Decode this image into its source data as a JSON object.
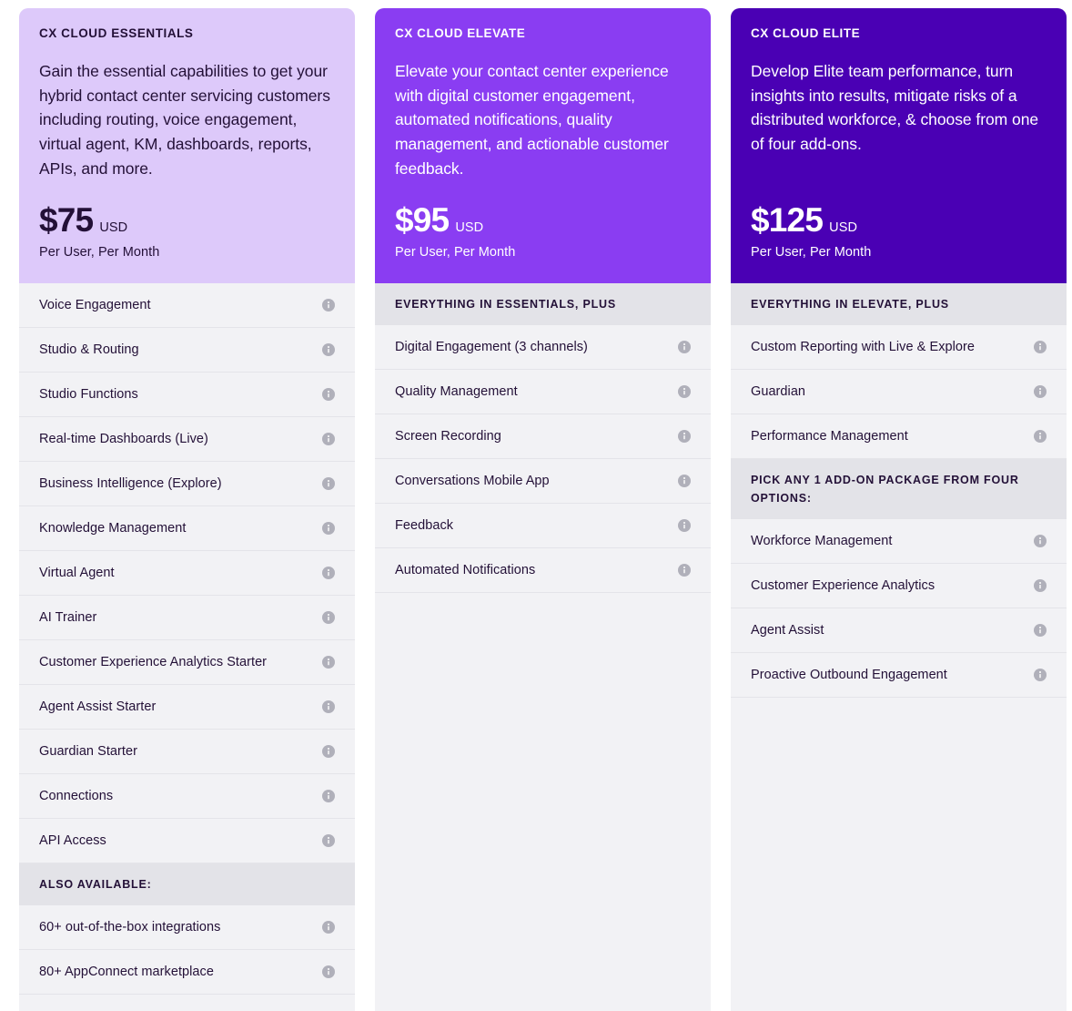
{
  "icons": {
    "info": "info-icon"
  },
  "colors": {
    "essentials_header_bg": "#ddc9fa",
    "elevate_header_bg": "#8a3df2",
    "elite_header_bg": "#4a00b4",
    "row_bg": "#f2f2f5",
    "section_heading_bg": "#e3e3e8",
    "text_dark": "#231037",
    "text_light": "#ffffff",
    "icon_gray": "#b0b0ba",
    "divider": "#e4e4e9"
  },
  "plans": [
    {
      "eyebrow": "CX CLOUD ESSENTIALS",
      "description": "Gain the essential capabilities to get your hybrid contact center servicing customers including routing, voice engagement, virtual agent, KM, dashboards, reports, APIs, and more.",
      "price_amount": "$75",
      "price_currency": "USD",
      "price_period": "Per User, Per Month",
      "blocks": [
        {
          "heading": null,
          "features": [
            "Voice Engagement",
            "Studio & Routing",
            "Studio Functions",
            "Real-time Dashboards (Live)",
            "Business Intelligence (Explore)",
            "Knowledge Management",
            "Virtual Agent",
            "AI Trainer",
            "Customer Experience Analytics Starter",
            "Agent Assist Starter",
            "Guardian Starter",
            "Connections",
            "API Access"
          ]
        },
        {
          "heading": "ALSO AVAILABLE:",
          "features": [
            "60+ out-of-the-box integrations",
            "80+ AppConnect marketplace"
          ]
        }
      ]
    },
    {
      "eyebrow": "CX CLOUD ELEVATE",
      "description": "Elevate your contact center experience with digital customer engagement, automated notifications, quality management, and actionable customer feedback.",
      "price_amount": "$95",
      "price_currency": "USD",
      "price_period": "Per User, Per Month",
      "blocks": [
        {
          "heading": "EVERYTHING IN ESSENTIALS, PLUS",
          "features": [
            "Digital Engagement (3 channels)",
            "Quality Management",
            "Screen Recording",
            "Conversations Mobile App",
            "Feedback",
            "Automated Notifications"
          ]
        }
      ]
    },
    {
      "eyebrow": "CX CLOUD ELITE",
      "description": "Develop Elite team performance, turn insights into results, mitigate risks of a distributed workforce, & choose from one of four add-ons.",
      "price_amount": "$125",
      "price_currency": "USD",
      "price_period": "Per User, Per Month",
      "blocks": [
        {
          "heading": "EVERYTHING IN ELEVATE, PLUS",
          "features": [
            "Custom Reporting with Live & Explore",
            "Guardian",
            "Performance Management"
          ]
        },
        {
          "heading": "PICK ANY 1 ADD-ON PACKAGE FROM FOUR OPTIONS:",
          "features": [
            "Workforce Management",
            "Customer Experience Analytics",
            "Agent Assist",
            "Proactive Outbound Engagement"
          ]
        }
      ]
    }
  ]
}
